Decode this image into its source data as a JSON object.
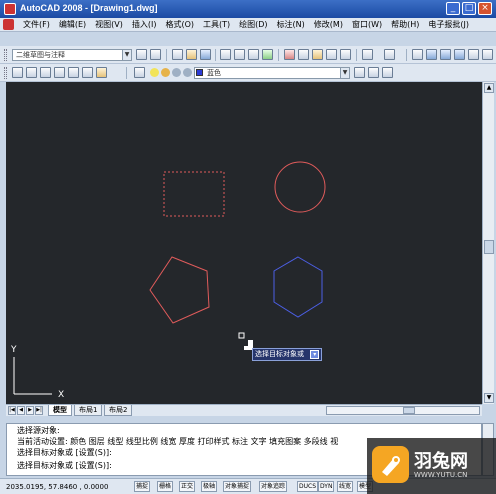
{
  "window": {
    "title": "AutoCAD 2008 - [Drawing1.dwg]",
    "minimize": "_",
    "maximize": "□",
    "close": "×"
  },
  "menu": {
    "items": [
      "文件(F)",
      "编辑(E)",
      "视图(V)",
      "插入(I)",
      "格式(O)",
      "工具(T)",
      "绘图(D)",
      "标注(N)",
      "修改(M)",
      "窗口(W)",
      "帮助(H)",
      "电子报批(J)"
    ],
    "mdi": {
      "minimize": "_",
      "restore": "□",
      "close": "×"
    }
  },
  "toolbar1": {
    "workspace": "二维草图与注释"
  },
  "toolbar2": {
    "layer_color": "蓝色"
  },
  "drawing": {
    "shapes": [
      {
        "name": "dashed-rectangle",
        "color": "#e05b5b"
      },
      {
        "name": "circle",
        "color": "#e05b5b"
      },
      {
        "name": "pentagon",
        "color": "#e05b5b"
      },
      {
        "name": "hexagon",
        "color": "#4c5fe6"
      }
    ],
    "tooltip": "选择目标对象或",
    "tooltip_button": "▾",
    "ucs": {
      "x": "X",
      "y": "Y"
    }
  },
  "tabs": {
    "model": "模型",
    "layout1": "布局1",
    "layout2": "布局2"
  },
  "command": {
    "lines": [
      "选择源对象:",
      "当前活动设置: 颜色 图层 线型 线型比例 线宽 厚度 打印样式 标注 文字 填充图案 多段线 视",
      "选择目标对象或 [设置(S)]:",
      "选择目标对象或 [设置(S)]:"
    ]
  },
  "status": {
    "coords": "2035.0195,  57.8460  ,  0.0000",
    "buttons": [
      "捕捉",
      "栅格",
      "正交",
      "极轴",
      "对象捕捉",
      "对象追踪",
      "DUCS",
      "DYN",
      "线宽",
      "模型"
    ]
  },
  "watermark": {
    "name": "羽兔网",
    "url": "WWW.YUTU.CN"
  },
  "colors": {
    "background": "#24272b",
    "red_object": "#e05b5b",
    "blue_object": "#4c5fe6"
  }
}
